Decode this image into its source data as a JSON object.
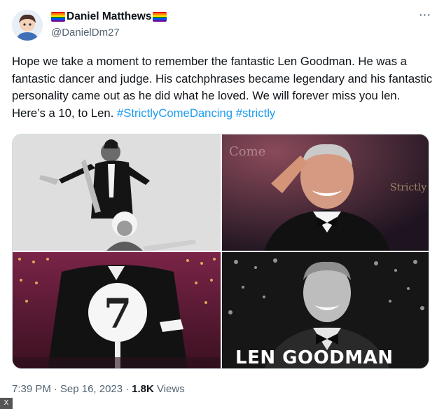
{
  "author": {
    "display_name": "Daniel Matthews",
    "handle": "@DanielDm27",
    "flag_colors": [
      "#e40303",
      "#ff8c00",
      "#ffed00",
      "#008026",
      "#004dff",
      "#750787"
    ]
  },
  "tweet": {
    "text_before": "Hope we take a moment to remember the fantastic Len Goodman. He was a fantastic dancer and judge. His catchphrases became legendary and his fantastic personality came out as he did what he loved. We will forever miss you len. Here’s a 10, to Len. ",
    "hashtag_1": "#StrictlyComeDancing",
    "hashtag_2": "#strictly",
    "link_color": "#1d9bf0"
  },
  "media": {
    "overlay_caption": "LEN GOODMAN",
    "scorecard_number": "7"
  },
  "meta": {
    "time": "7:39 PM",
    "date": "Sep 16, 20​23",
    "views_count": "1.8K",
    "views_label": "Views"
  },
  "icons": {
    "more": "more-icon",
    "corner": "x-logo-icon"
  },
  "corner_label": "X"
}
